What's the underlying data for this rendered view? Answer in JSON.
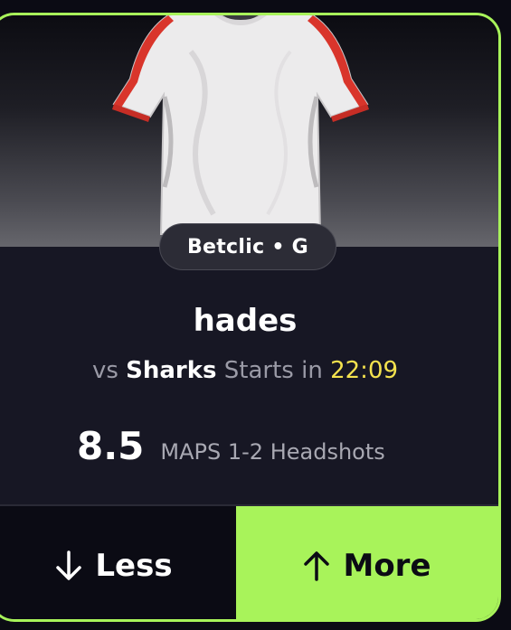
{
  "card": {
    "league_pill": "Betclic • G",
    "player_name": "hades",
    "vs_prefix": "vs",
    "opponent": "Sharks",
    "starts_in_label": "Starts in",
    "countdown": "22:09",
    "line_value": "8.5",
    "stat_label": "MAPS 1-2 Headshots"
  },
  "actions": {
    "less_label": "Less",
    "more_label": "More"
  },
  "colors": {
    "accent": "#a8f35a",
    "countdown": "#f4e24e",
    "background": "#0b0b14",
    "card": "#171724"
  },
  "icons": {
    "less": "arrow-down-icon",
    "more": "arrow-up-icon"
  }
}
